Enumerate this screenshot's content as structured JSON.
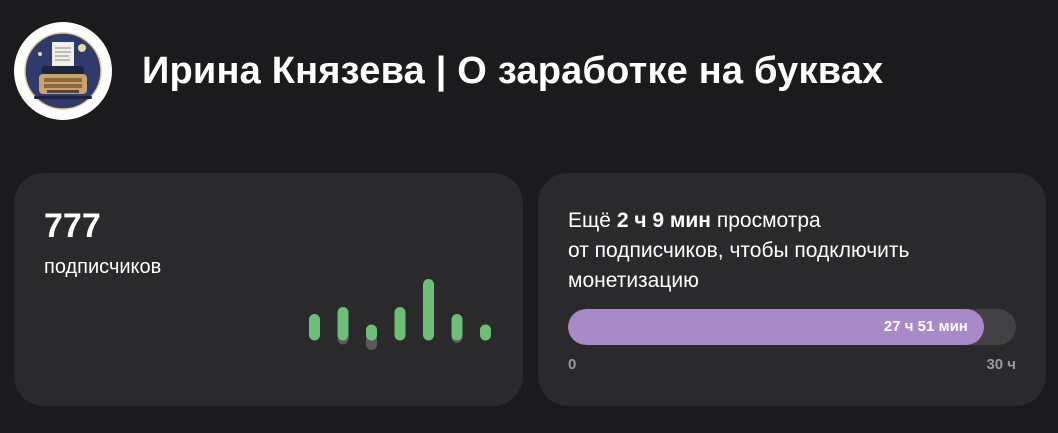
{
  "header": {
    "title": "Ирина Князева | О заработке на буквах",
    "avatar_icon": "typewriter-icon"
  },
  "subscribers": {
    "count": "777",
    "label": "подписчиков",
    "colors": {
      "up": "#6bbf77",
      "down": "#5a5a5c"
    }
  },
  "chart_data": {
    "type": "bar",
    "series": [
      {
        "values": [
          3,
          4,
          1.5,
          4,
          8,
          3,
          1.5
        ]
      },
      {
        "values": [
          0.5,
          1.2,
          2,
          0.3,
          0.3,
          1,
          0.3
        ]
      }
    ]
  },
  "monetization": {
    "text_prefix": "Ещё",
    "remaining": "2 ч 9 мин",
    "text_suffix": "просмотра",
    "text_line2": "от подписчиков, чтобы подключить",
    "text_line3": "монетизацию",
    "progress_label": "27 ч 51 мин",
    "progress_fraction": 0.9283,
    "scale_min": "0",
    "scale_max": "30 ч",
    "colors": {
      "fill": "#a88ac8",
      "track": "#424244"
    }
  }
}
